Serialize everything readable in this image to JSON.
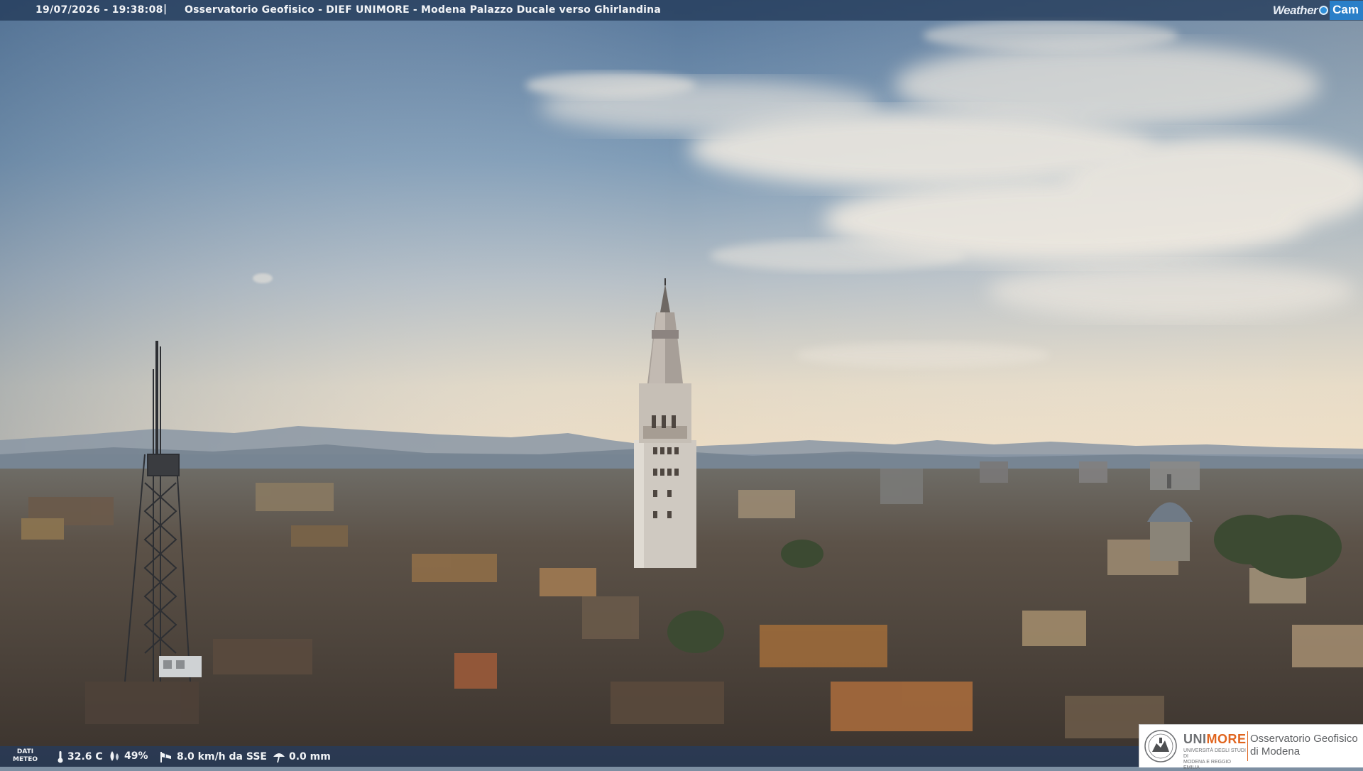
{
  "overlay": {
    "timestamp": "19/07/2026 - 19:38:08",
    "separator": "|",
    "title": "Osservatorio Geofisico - DIEF UNIMORE - Modena Palazzo Ducale verso Ghirlandina",
    "brand_weather": "Weather",
    "brand_cam": "Cam"
  },
  "meteo": {
    "label_line1": "DATI",
    "label_line2": "METEO",
    "temperature": "32.6 C",
    "temperature_icon": "thermometer-icon",
    "humidity": "49%",
    "humidity_icon": "drop-icon",
    "wind": "8.0 km/h da SSE",
    "wind_icon": "windsock-icon",
    "rain": "0.0 mm",
    "rain_icon": "umbrella-icon"
  },
  "logo": {
    "uni_part1": "UNI",
    "uni_part2": "MORE",
    "university_line1": "UNIVERSITÀ DEGLI STUDI DI",
    "university_line2": "MODENA E REGGIO EMILIA",
    "observatory_line1": "Osservatorio Geofisico",
    "observatory_line2": "di Modena",
    "accent_color": "#e0651f"
  },
  "scene": {
    "description_colors": {
      "sky_top": "#5e7c98",
      "sky_horizon": "#e8dcc8",
      "roofs": "#4a4038"
    }
  }
}
